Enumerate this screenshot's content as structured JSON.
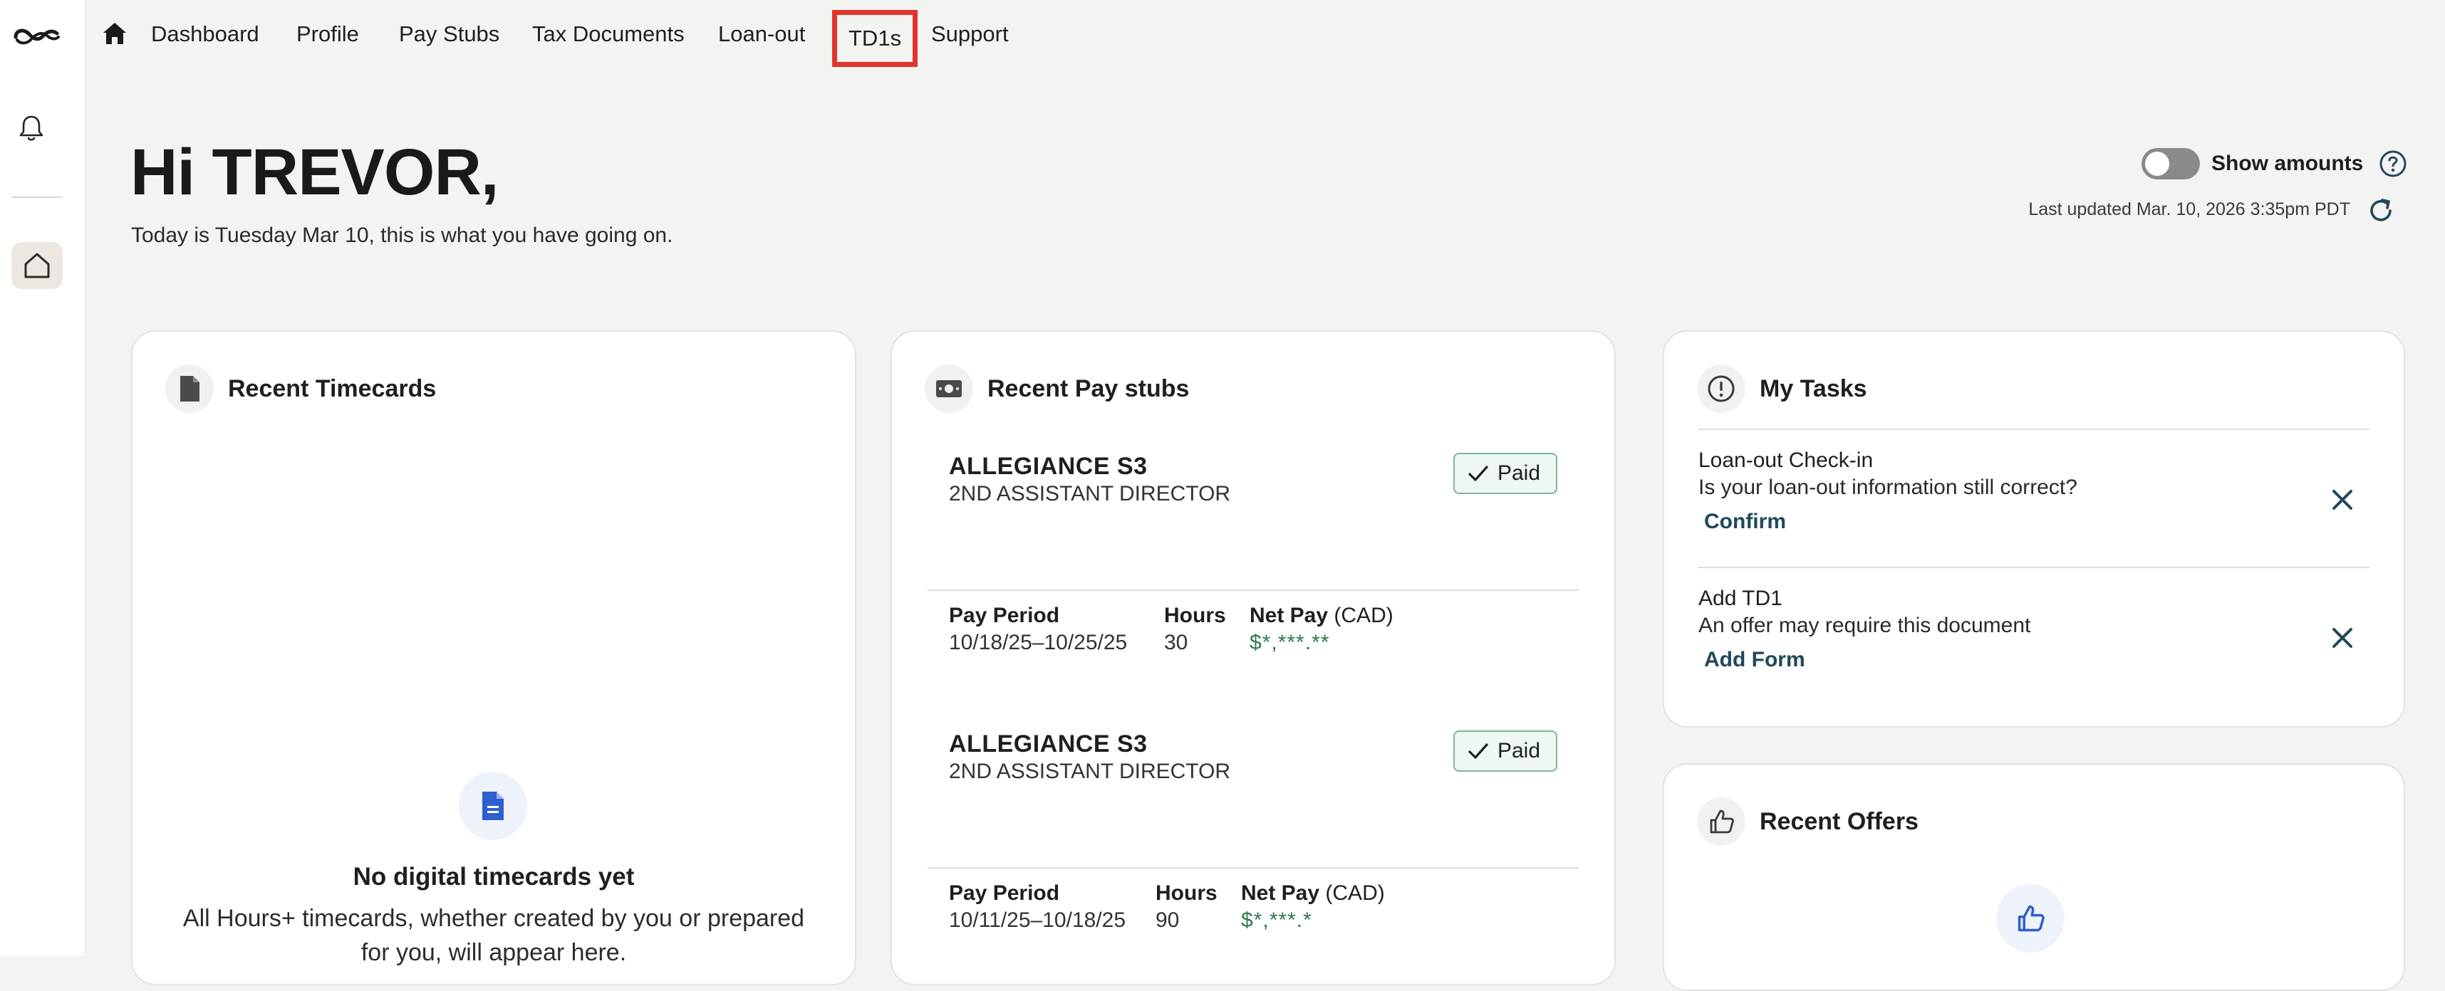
{
  "nav": {
    "items": [
      {
        "label": "Dashboard"
      },
      {
        "label": "Profile"
      },
      {
        "label": "Pay Stubs"
      },
      {
        "label": "Tax Documents"
      },
      {
        "label": "Loan-out"
      },
      {
        "label": "TD1s"
      },
      {
        "label": "Support"
      }
    ],
    "highlighted": "TD1s"
  },
  "greeting": {
    "title": "Hi TREVOR,",
    "subtitle": "Today is Tuesday Mar 10, this is what you have going on."
  },
  "amounts_toggle": {
    "label": "Show amounts",
    "on": false
  },
  "last_updated": "Last updated Mar. 10, 2026 3:35pm PDT",
  "timecards": {
    "title": "Recent Timecards",
    "empty_title": "No digital timecards yet",
    "empty_desc": "All Hours+ timecards, whether created by you or prepared for you, will appear here."
  },
  "paystubs": {
    "title": "Recent Pay stubs",
    "col_period": "Pay Period",
    "col_hours": "Hours",
    "col_net": "Net Pay",
    "col_net_unit": "(CAD)",
    "items": [
      {
        "production": "ALLEGIANCE S3",
        "role": "2ND ASSISTANT DIRECTOR",
        "status": "Paid",
        "period": "10/18/25–10/25/25",
        "hours": "30",
        "net": "$*,***.**"
      },
      {
        "production": "ALLEGIANCE S3",
        "role": "2ND ASSISTANT DIRECTOR",
        "status": "Paid",
        "period": "10/11/25–10/18/25",
        "hours": "90",
        "net": "$*,***.*"
      }
    ]
  },
  "tasks": {
    "title": "My Tasks",
    "items": [
      {
        "title": "Loan-out Check-in",
        "desc": "Is your loan-out information still correct?",
        "action": "Confirm"
      },
      {
        "title": "Add TD1",
        "desc": "An offer may require this document",
        "action": "Add Form"
      }
    ]
  },
  "offers": {
    "title": "Recent Offers"
  },
  "colors": {
    "accent": "#21485a",
    "paid_green": "#2f7a4d",
    "highlight": "#e0352b",
    "file_blue": "#2d5fd0"
  }
}
